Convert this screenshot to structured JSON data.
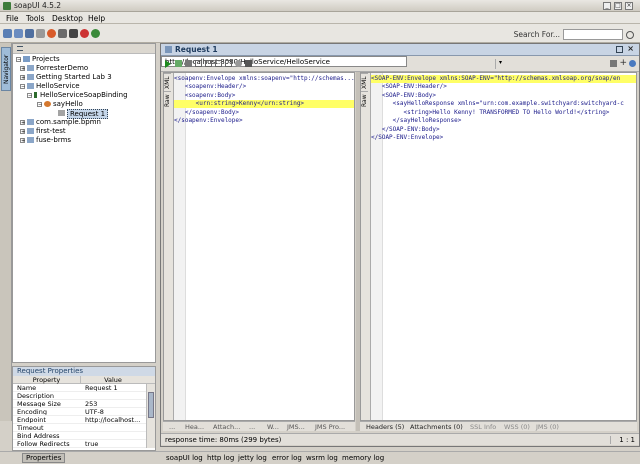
{
  "window": {
    "title": "soapUI 4.5.2"
  },
  "menu": [
    "File",
    "Tools",
    "Desktop",
    "Help"
  ],
  "toolbar": {
    "search_label": "Search For..."
  },
  "navigator": {
    "tab_label": "Navigator"
  },
  "tree": {
    "nodes": [
      "Projects",
      "ForresterDemo",
      "Getting Started Lab 3",
      "HelloService",
      "HelloServiceSoapBinding",
      "sayHello",
      "Request 1",
      "com.sample.bpmn",
      "first-test",
      "fuse-brms"
    ]
  },
  "request_properties": {
    "title": "Request Properties",
    "columns": [
      "Property",
      "Value"
    ],
    "rows": [
      [
        "Name",
        "Request 1"
      ],
      [
        "Description",
        ""
      ],
      [
        "Message Size",
        "253"
      ],
      [
        "Encoding",
        "UTF-8"
      ],
      [
        "Endpoint",
        "http://localhost..."
      ],
      [
        "Timeout",
        ""
      ],
      [
        "Bind Address",
        ""
      ],
      [
        "Follow Redirects",
        "true"
      ]
    ]
  },
  "bottom": {
    "properties_button": "Properties",
    "logs": [
      "soapUI log",
      "http log",
      "jetty log",
      "error log",
      "wsrm log",
      "memory log"
    ]
  },
  "request": {
    "title": "Request 1",
    "url": "http://localhost:8080/HelloService/HelloService",
    "left_tabs": [
      "XML",
      "Raw"
    ],
    "right_tabs": [
      "XML",
      "Raw"
    ],
    "request_xml": [
      "<soapenv:Envelope xmlns:soapenv=\"http://schemas...",
      "   <soapenv:Header/>",
      "   <soapenv:Body>",
      "      <urn:string>Kenny</urn:string>",
      "   </soapenv:Body>",
      "</soapenv:Envelope>"
    ],
    "response_xml": [
      "<SOAP-ENV:Envelope xmlns:SOAP-ENV=\"http://schemas.xmlsoap.org/soap/en",
      "   <SOAP-ENV:Header/>",
      "   <SOAP-ENV:Body>",
      "      <sayHelloResponse xmlns=\"urn:com.example.switchyard:switchyard-c",
      "         <string>Hello Kenny! TRANSFORMED TO Hello World!</string>",
      "      </sayHelloResponse>",
      "   </SOAP-ENV:Body>",
      "</SOAP-ENV:Envelope>"
    ],
    "request_bottom_tabs": [
      "...",
      "Hea...",
      "Attach...",
      "...",
      "W...",
      "JMS...",
      "JMS Pro..."
    ],
    "response_bottom_tabs": [
      "Headers (5)",
      "Attachments (0)",
      "SSL Info",
      "WSS (0)",
      "JMS (0)"
    ],
    "status": "response time: 80ms (299 bytes)",
    "cursor": "1 : 1"
  }
}
